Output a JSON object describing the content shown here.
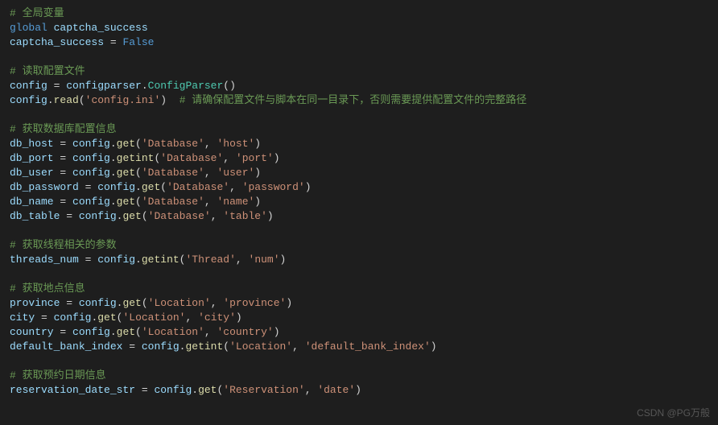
{
  "c_global": "# 全局变量",
  "kw_global": "global",
  "v_cs": "captcha_success",
  "v_cs2": "captcha_success",
  "eq": " = ",
  "b_false": "False",
  "c_readcfg": "# 读取配置文件",
  "v_config": "config",
  "v_configparser": "configparser",
  "cl_ConfigParser": "ConfigParser",
  "fn_read": "read",
  "s_configini": "'config.ini'",
  "c_cfgnote": "# 请确保配置文件与脚本在同一目录下，否则需要提供配置文件的完整路径",
  "c_dbinfo": "# 获取数据库配置信息",
  "v_dbhost": "db_host",
  "v_dbport": "db_port",
  "v_dbuser": "db_user",
  "v_dbpass": "db_password",
  "v_dbname": "db_name",
  "v_dbtable": "db_table",
  "fn_get": "get",
  "fn_getint": "getint",
  "s_Database": "'Database'",
  "s_host": "'host'",
  "s_port": "'port'",
  "s_user": "'user'",
  "s_password": "'password'",
  "s_name": "'name'",
  "s_table": "'table'",
  "c_thread": "# 获取线程相关的参数",
  "v_threadsnum": "threads_num",
  "s_Thread": "'Thread'",
  "s_num": "'num'",
  "c_loc": "# 获取地点信息",
  "v_province": "province",
  "v_city": "city",
  "v_country": "country",
  "v_dbi": "default_bank_index",
  "s_Location": "'Location'",
  "s_province": "'province'",
  "s_city": "'city'",
  "s_country": "'country'",
  "s_dbi": "'default_bank_index'",
  "c_res": "# 获取预约日期信息",
  "v_resdate": "reservation_date_str",
  "s_Reservation": "'Reservation'",
  "s_date": "'date'",
  "watermark": "CSDN @PG万般"
}
